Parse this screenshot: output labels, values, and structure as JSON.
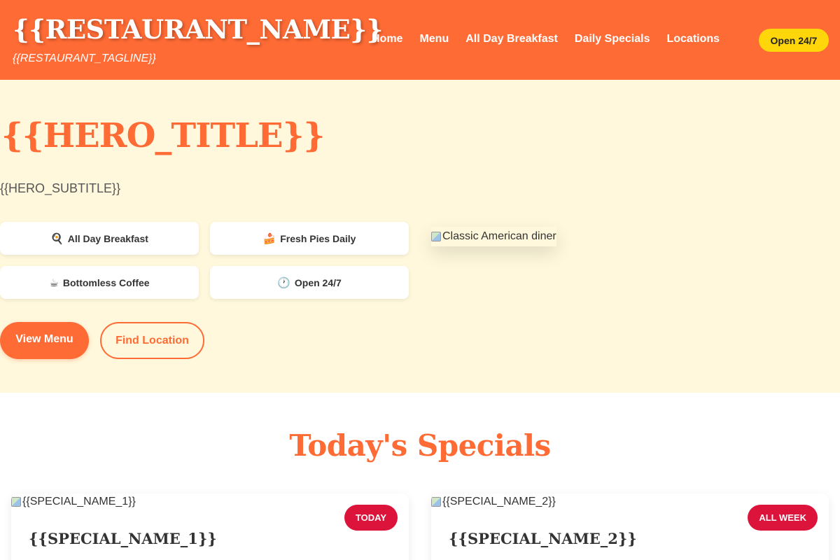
{
  "header": {
    "restaurant_name": "{{RESTAURANT_NAME}}",
    "tagline": "{{RESTAURANT_TAGLINE}}",
    "nav": [
      "Home",
      "Menu",
      "All Day Breakfast",
      "Daily Specials",
      "Locations"
    ],
    "badge": "Open 24/7"
  },
  "hero": {
    "title": "{{HERO_TITLE}}",
    "subtitle": "{{HERO_SUBTITLE}}",
    "features": [
      {
        "icon": "🍳",
        "label": "All Day Breakfast"
      },
      {
        "icon": "🍰",
        "label": "Fresh Pies Daily"
      },
      {
        "icon": "☕",
        "label": "Bottomless Coffee"
      },
      {
        "icon": "🕐",
        "label": "Open 24/7"
      }
    ],
    "image_alt": "Classic American diner",
    "primary_button": "View Menu",
    "secondary_button": "Find Location"
  },
  "specials": {
    "heading": "Today's Specials",
    "cards": [
      {
        "image_alt": "{{SPECIAL_NAME_1}}",
        "tag": "TODAY",
        "name": "{{SPECIAL_NAME_1}}"
      },
      {
        "image_alt": "{{SPECIAL_NAME_2}}",
        "tag": "ALL WEEK",
        "name": "{{SPECIAL_NAME_2}}"
      }
    ]
  },
  "colors": {
    "primary": "#ff6b35",
    "hero_background": "#fff8dc",
    "badge": "#ffd60a",
    "tag": "#dc143c"
  }
}
